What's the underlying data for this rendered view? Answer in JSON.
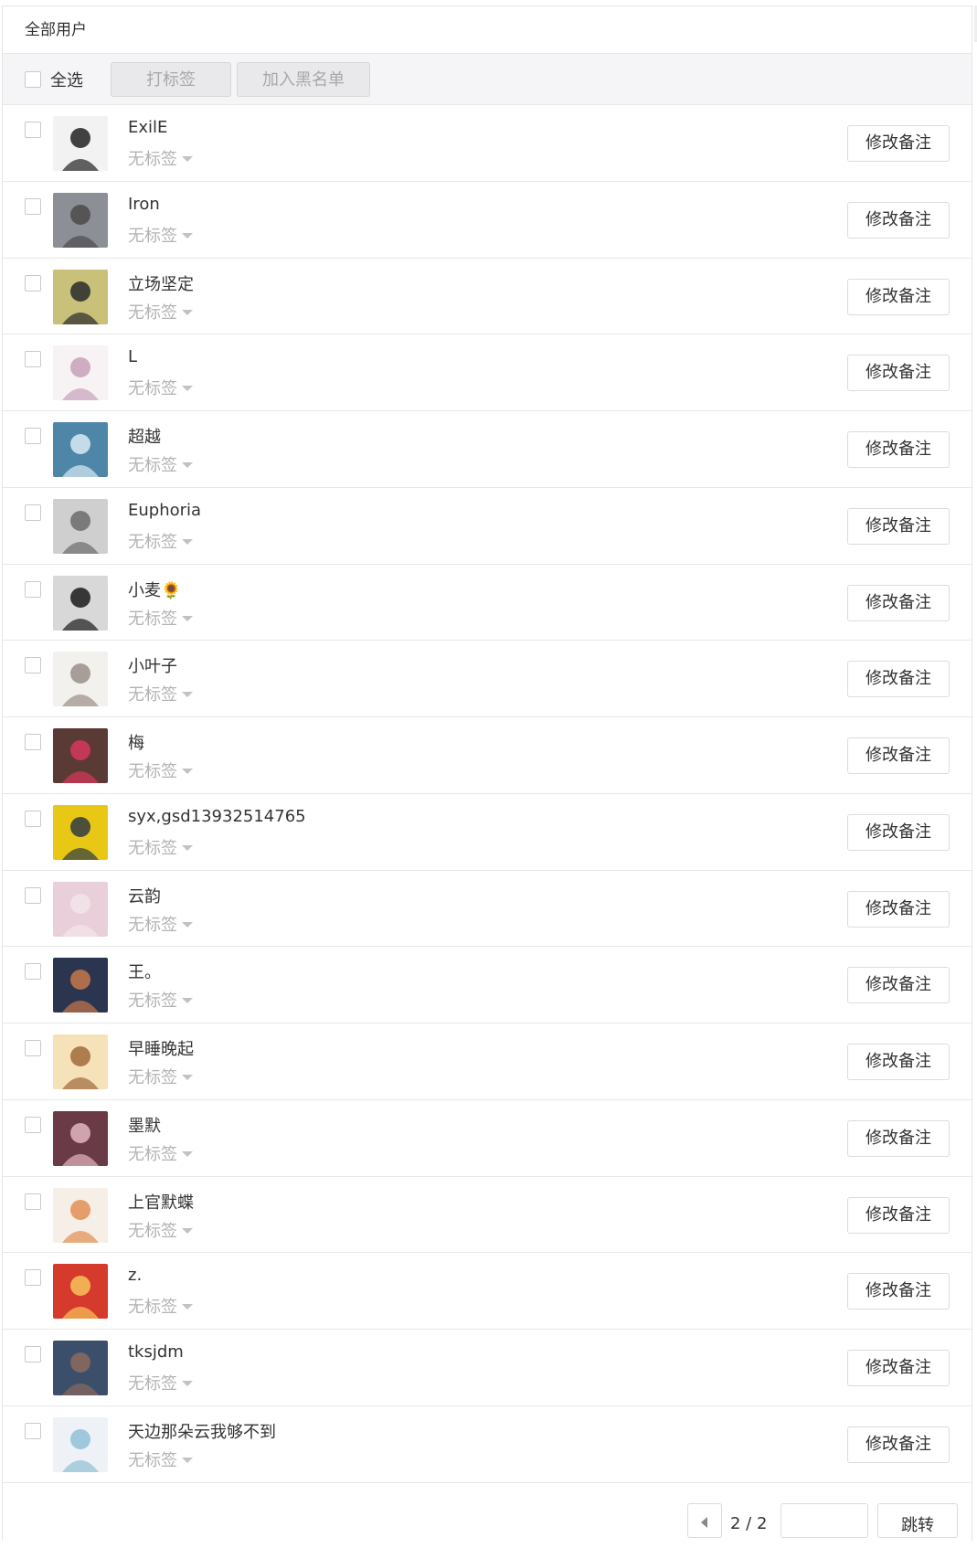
{
  "header": {
    "title": "全部用户"
  },
  "toolbar": {
    "select_all_label": "全选",
    "tag_button": "打标签",
    "blacklist_button": "加入黑名单"
  },
  "users": [
    {
      "name": "ExilE",
      "tag": "无标签",
      "avatar": "avatar-dark-portrait",
      "remark_button": "修改备注"
    },
    {
      "name": "Iron",
      "tag": "无标签",
      "avatar": "avatar-person-grey",
      "remark_button": "修改备注"
    },
    {
      "name": "立场坚定",
      "tag": "无标签",
      "avatar": "avatar-smiling-man",
      "remark_button": "修改备注"
    },
    {
      "name": "L",
      "tag": "无标签",
      "avatar": "avatar-cartoon-girl",
      "remark_button": "修改备注"
    },
    {
      "name": "超越",
      "tag": "无标签",
      "avatar": "avatar-sea-wave",
      "remark_button": "修改备注"
    },
    {
      "name": "Euphoria",
      "tag": "无标签",
      "avatar": "avatar-grey-object",
      "remark_button": "修改备注"
    },
    {
      "name": "小麦🌻",
      "tag": "无标签",
      "avatar": "avatar-dark-girl",
      "remark_button": "修改备注"
    },
    {
      "name": "小叶子",
      "tag": "无标签",
      "avatar": "avatar-cartoon-group",
      "remark_button": "修改备注"
    },
    {
      "name": "梅",
      "tag": "无标签",
      "avatar": "avatar-plum-blossom",
      "remark_button": "修改备注"
    },
    {
      "name": "syx,gsd13932514765",
      "tag": "无标签",
      "avatar": "avatar-yellow-sign",
      "remark_button": "修改备注"
    },
    {
      "name": "云韵",
      "tag": "无标签",
      "avatar": "avatar-pink-girl",
      "remark_button": "修改备注"
    },
    {
      "name": "王。",
      "tag": "无标签",
      "avatar": "avatar-night-sky",
      "remark_button": "修改备注"
    },
    {
      "name": "早睡晚起",
      "tag": "无标签",
      "avatar": "avatar-cartoon-boy",
      "remark_button": "修改备注"
    },
    {
      "name": "墨默",
      "tag": "无标签",
      "avatar": "avatar-couple-photo",
      "remark_button": "修改备注"
    },
    {
      "name": "上官默蝶",
      "tag": "无标签",
      "avatar": "avatar-ancient-girl",
      "remark_button": "修改备注"
    },
    {
      "name": "z.",
      "tag": "无标签",
      "avatar": "avatar-tiger-red",
      "remark_button": "修改备注"
    },
    {
      "name": "tksjdm",
      "tag": "无标签",
      "avatar": "avatar-blue-painting",
      "remark_button": "修改备注"
    },
    {
      "name": "天边那朵云我够不到",
      "tag": "无标签",
      "avatar": "avatar-anime-girl",
      "remark_button": "修改备注"
    }
  ],
  "avatar_colors": {
    "avatar-dark-portrait": [
      "#f2f2f2",
      "#222222"
    ],
    "avatar-person-grey": [
      "#8c8f96",
      "#4e4a4a"
    ],
    "avatar-smiling-man": [
      "#c9c07a",
      "#2a2a2a"
    ],
    "avatar-cartoon-girl": [
      "#f7f3f5",
      "#c7a0b8"
    ],
    "avatar-sea-wave": [
      "#4e86a8",
      "#d9ebf2"
    ],
    "avatar-grey-object": [
      "#cfcfcf",
      "#6b6b6b"
    ],
    "avatar-dark-girl": [
      "#d8d8d8",
      "#1b1b1b"
    ],
    "avatar-cartoon-group": [
      "#f3f1ee",
      "#9a8f8a"
    ],
    "avatar-plum-blossom": [
      "#5a3a34",
      "#d6385a"
    ],
    "avatar-yellow-sign": [
      "#e8c814",
      "#2f3a42"
    ],
    "avatar-pink-girl": [
      "#e9cfd9",
      "#f2e5ea"
    ],
    "avatar-night-sky": [
      "#2b3550",
      "#c7784a"
    ],
    "avatar-cartoon-boy": [
      "#f5e2b8",
      "#a06a3c"
    ],
    "avatar-couple-photo": [
      "#6a3a46",
      "#e2b7bf"
    ],
    "avatar-ancient-girl": [
      "#f5efe7",
      "#e28e52"
    ],
    "avatar-tiger-red": [
      "#d63a2d",
      "#f7c35a"
    ],
    "avatar-blue-painting": [
      "#3b4f6b",
      "#8c6a5c"
    ],
    "avatar-anime-girl": [
      "#eef2f6",
      "#8fc1d6"
    ]
  },
  "pagination": {
    "page_info": "2 / 2",
    "jump_label": "跳转",
    "input_value": ""
  }
}
